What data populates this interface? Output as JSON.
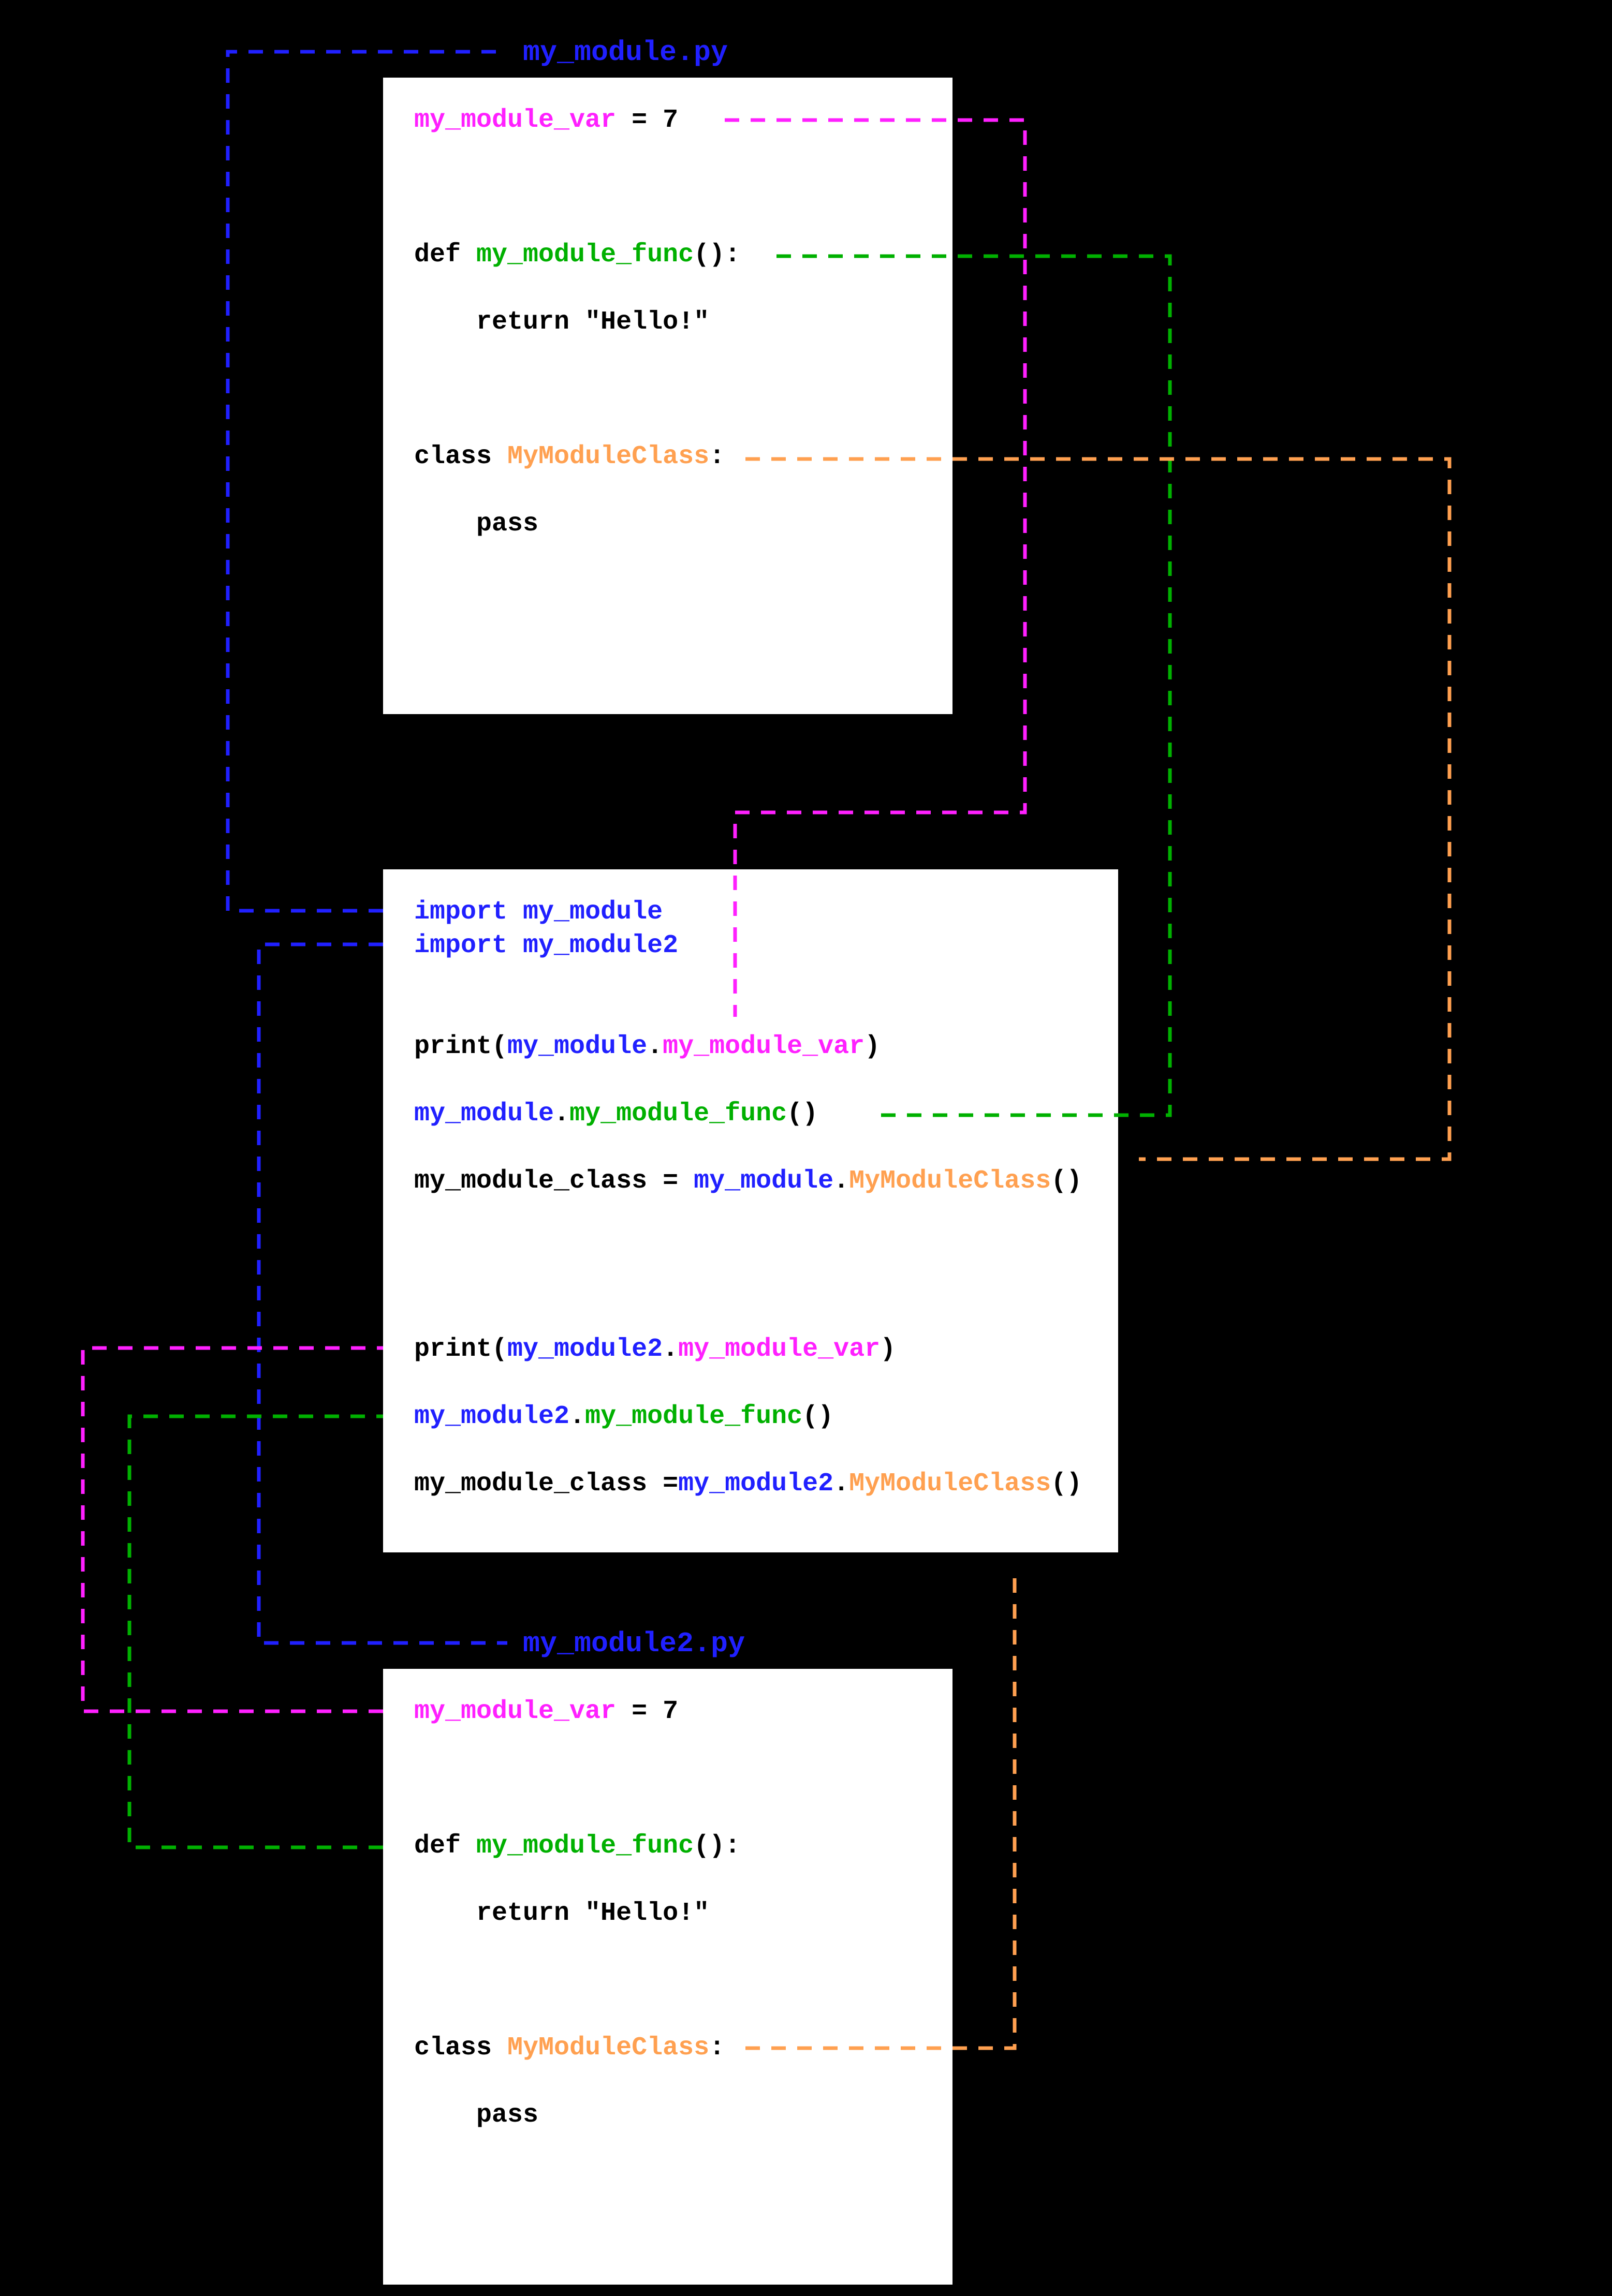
{
  "file1": {
    "name": "my_module.py",
    "var_name": "my_module_var",
    "var_rest": " = 7",
    "def_kw": "def ",
    "func_name": "my_module_func",
    "def_rest": "():",
    "return_line": "    return \"Hello!\"",
    "class_kw": "class ",
    "class_name": "MyModuleClass",
    "class_rest": ":",
    "pass_line": "    pass"
  },
  "file2": {
    "name": "my_module2.py",
    "var_name": "my_module_var",
    "var_rest": " = 7",
    "def_kw": "def ",
    "func_name": "my_module_func",
    "def_rest": "():",
    "return_line": "    return \"Hello!\"",
    "class_kw": "class ",
    "class_name": "MyModuleClass",
    "class_rest": ":",
    "pass_line": "    pass"
  },
  "main": {
    "import1_kw": "import ",
    "import1_mod": "my_module",
    "import2_kw": "import ",
    "import2_mod": "my_module2",
    "p1_a": "print(",
    "p1_mod": "my_module",
    "p1_dot": ".",
    "p1_var": "my_module_var",
    "p1_b": ")",
    "c1_mod": "my_module",
    "c1_dot": ".",
    "c1_func": "my_module_func",
    "c1_b": "()",
    "a1_lhs": "my_module_class = ",
    "a1_mod": "my_module",
    "a1_dot": ".",
    "a1_cls": "MyModuleClass",
    "a1_b": "()",
    "p2_a": "print(",
    "p2_mod": "my_module2",
    "p2_dot": ".",
    "p2_var": "my_module_var",
    "p2_b": ")",
    "c2_mod": "my_module2",
    "c2_dot": ".",
    "c2_func": "my_module_func",
    "c2_b": "()",
    "a2_lhs": "my_module_class =",
    "a2_mod": "my_module2",
    "a2_dot": ".",
    "a2_cls": "MyModuleClass",
    "a2_b": "()"
  },
  "colors": {
    "blue": "#2020ff",
    "magenta": "#ff20ff",
    "green": "#00b000",
    "orange": "#ffa050"
  }
}
